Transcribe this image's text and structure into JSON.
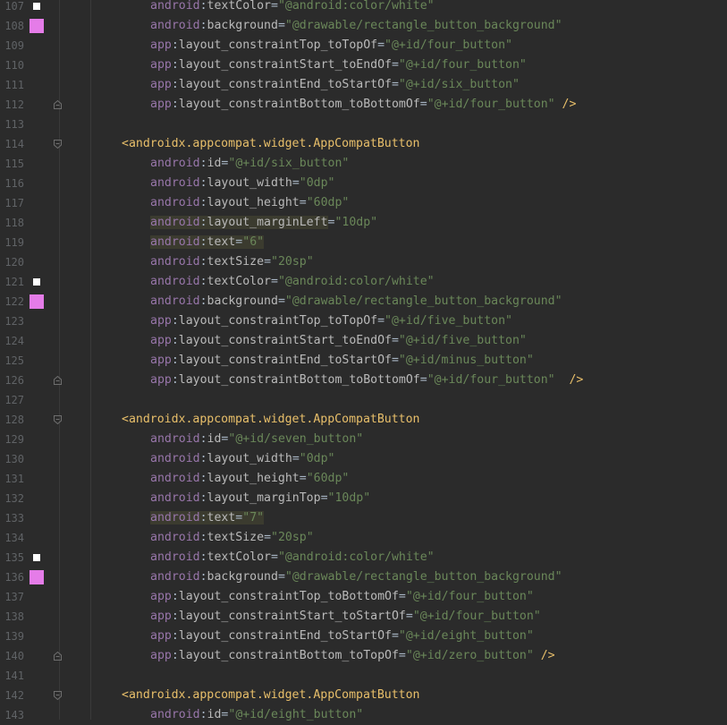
{
  "editor": {
    "lines": [
      {
        "num": "107",
        "indent": 2,
        "segments": [
          {
            "c": "ns-android",
            "t": "android"
          },
          {
            "c": "punct",
            "t": ":"
          },
          {
            "c": "attr",
            "t": "textColor"
          },
          {
            "c": "punct",
            "t": "="
          },
          {
            "c": "val",
            "t": "\"@android:color/white\""
          }
        ],
        "gutter": "white"
      },
      {
        "num": "108",
        "indent": 2,
        "segments": [
          {
            "c": "ns-android",
            "t": "android"
          },
          {
            "c": "punct",
            "t": ":"
          },
          {
            "c": "attr",
            "t": "background"
          },
          {
            "c": "punct",
            "t": "="
          },
          {
            "c": "val",
            "t": "\"@drawable/rectangle_button_background\""
          }
        ],
        "gutter": "pink"
      },
      {
        "num": "109",
        "indent": 2,
        "segments": [
          {
            "c": "ns-app",
            "t": "app"
          },
          {
            "c": "punct",
            "t": ":"
          },
          {
            "c": "attr",
            "t": "layout_constraintTop_toTopOf"
          },
          {
            "c": "punct",
            "t": "="
          },
          {
            "c": "val",
            "t": "\"@+id/four_button\""
          }
        ]
      },
      {
        "num": "110",
        "indent": 2,
        "segments": [
          {
            "c": "ns-app",
            "t": "app"
          },
          {
            "c": "punct",
            "t": ":"
          },
          {
            "c": "attr",
            "t": "layout_constraintStart_toEndOf"
          },
          {
            "c": "punct",
            "t": "="
          },
          {
            "c": "val",
            "t": "\"@+id/four_button\""
          }
        ]
      },
      {
        "num": "111",
        "indent": 2,
        "segments": [
          {
            "c": "ns-app",
            "t": "app"
          },
          {
            "c": "punct",
            "t": ":"
          },
          {
            "c": "attr",
            "t": "layout_constraintEnd_toStartOf"
          },
          {
            "c": "punct",
            "t": "="
          },
          {
            "c": "val",
            "t": "\"@+id/six_button\""
          }
        ]
      },
      {
        "num": "112",
        "indent": 2,
        "segments": [
          {
            "c": "ns-app",
            "t": "app"
          },
          {
            "c": "punct",
            "t": ":"
          },
          {
            "c": "attr",
            "t": "layout_constraintBottom_toBottomOf"
          },
          {
            "c": "punct",
            "t": "="
          },
          {
            "c": "val",
            "t": "\"@+id/four_button\""
          },
          {
            "c": "tag",
            "t": " />"
          }
        ],
        "fold": "end"
      },
      {
        "num": "113",
        "indent": 0,
        "segments": []
      },
      {
        "num": "114",
        "indent": 1,
        "segments": [
          {
            "c": "tag",
            "t": "<androidx.appcompat.widget.AppCompatButton"
          }
        ],
        "fold": "start"
      },
      {
        "num": "115",
        "indent": 2,
        "segments": [
          {
            "c": "ns-android",
            "t": "android"
          },
          {
            "c": "punct",
            "t": ":"
          },
          {
            "c": "attr",
            "t": "id"
          },
          {
            "c": "punct",
            "t": "="
          },
          {
            "c": "val",
            "t": "\"@+id/six_button\""
          }
        ]
      },
      {
        "num": "116",
        "indent": 2,
        "segments": [
          {
            "c": "ns-android",
            "t": "android"
          },
          {
            "c": "punct",
            "t": ":"
          },
          {
            "c": "attr",
            "t": "layout_width"
          },
          {
            "c": "punct",
            "t": "="
          },
          {
            "c": "val",
            "t": "\"0dp\""
          }
        ]
      },
      {
        "num": "117",
        "indent": 2,
        "segments": [
          {
            "c": "ns-android",
            "t": "android"
          },
          {
            "c": "punct",
            "t": ":"
          },
          {
            "c": "attr",
            "t": "layout_height"
          },
          {
            "c": "punct",
            "t": "="
          },
          {
            "c": "val",
            "t": "\"60dp\""
          }
        ]
      },
      {
        "num": "118",
        "indent": 2,
        "segments": [
          {
            "c": "ns-android hl",
            "t": "android"
          },
          {
            "c": "punct hl",
            "t": ":"
          },
          {
            "c": "attr hl",
            "t": "layout_marginLeft"
          },
          {
            "c": "punct",
            "t": "="
          },
          {
            "c": "val",
            "t": "\"10dp\""
          }
        ]
      },
      {
        "num": "119",
        "indent": 2,
        "segments": [
          {
            "c": "ns-android hl",
            "t": "android"
          },
          {
            "c": "punct hl",
            "t": ":"
          },
          {
            "c": "attr hl",
            "t": "text"
          },
          {
            "c": "punct hl",
            "t": "="
          },
          {
            "c": "val hl",
            "t": "\"6\""
          }
        ]
      },
      {
        "num": "120",
        "indent": 2,
        "segments": [
          {
            "c": "ns-android",
            "t": "android"
          },
          {
            "c": "punct",
            "t": ":"
          },
          {
            "c": "attr",
            "t": "textSize"
          },
          {
            "c": "punct",
            "t": "="
          },
          {
            "c": "val",
            "t": "\"20sp\""
          }
        ]
      },
      {
        "num": "121",
        "indent": 2,
        "segments": [
          {
            "c": "ns-android",
            "t": "android"
          },
          {
            "c": "punct",
            "t": ":"
          },
          {
            "c": "attr",
            "t": "textColor"
          },
          {
            "c": "punct",
            "t": "="
          },
          {
            "c": "val",
            "t": "\"@android:color/white\""
          }
        ],
        "gutter": "white"
      },
      {
        "num": "122",
        "indent": 2,
        "segments": [
          {
            "c": "ns-android",
            "t": "android"
          },
          {
            "c": "punct",
            "t": ":"
          },
          {
            "c": "attr",
            "t": "background"
          },
          {
            "c": "punct",
            "t": "="
          },
          {
            "c": "val",
            "t": "\"@drawable/rectangle_button_background\""
          }
        ],
        "gutter": "pink"
      },
      {
        "num": "123",
        "indent": 2,
        "segments": [
          {
            "c": "ns-app",
            "t": "app"
          },
          {
            "c": "punct",
            "t": ":"
          },
          {
            "c": "attr",
            "t": "layout_constraintTop_toTopOf"
          },
          {
            "c": "punct",
            "t": "="
          },
          {
            "c": "val",
            "t": "\"@+id/five_button\""
          }
        ]
      },
      {
        "num": "124",
        "indent": 2,
        "segments": [
          {
            "c": "ns-app",
            "t": "app"
          },
          {
            "c": "punct",
            "t": ":"
          },
          {
            "c": "attr",
            "t": "layout_constraintStart_toEndOf"
          },
          {
            "c": "punct",
            "t": "="
          },
          {
            "c": "val",
            "t": "\"@+id/five_button\""
          }
        ]
      },
      {
        "num": "125",
        "indent": 2,
        "segments": [
          {
            "c": "ns-app",
            "t": "app"
          },
          {
            "c": "punct",
            "t": ":"
          },
          {
            "c": "attr",
            "t": "layout_constraintEnd_toStartOf"
          },
          {
            "c": "punct",
            "t": "="
          },
          {
            "c": "val",
            "t": "\"@+id/minus_button\""
          }
        ]
      },
      {
        "num": "126",
        "indent": 2,
        "segments": [
          {
            "c": "ns-app",
            "t": "app"
          },
          {
            "c": "punct",
            "t": ":"
          },
          {
            "c": "attr",
            "t": "layout_constraintBottom_toBottomOf"
          },
          {
            "c": "punct",
            "t": "="
          },
          {
            "c": "val",
            "t": "\"@+id/four_button\""
          },
          {
            "c": "tag",
            "t": "  />"
          }
        ],
        "fold": "end"
      },
      {
        "num": "127",
        "indent": 0,
        "segments": []
      },
      {
        "num": "128",
        "indent": 1,
        "segments": [
          {
            "c": "tag",
            "t": "<androidx.appcompat.widget.AppCompatButton"
          }
        ],
        "fold": "start"
      },
      {
        "num": "129",
        "indent": 2,
        "segments": [
          {
            "c": "ns-android",
            "t": "android"
          },
          {
            "c": "punct",
            "t": ":"
          },
          {
            "c": "attr",
            "t": "id"
          },
          {
            "c": "punct",
            "t": "="
          },
          {
            "c": "val",
            "t": "\"@+id/seven_button\""
          }
        ]
      },
      {
        "num": "130",
        "indent": 2,
        "segments": [
          {
            "c": "ns-android",
            "t": "android"
          },
          {
            "c": "punct",
            "t": ":"
          },
          {
            "c": "attr",
            "t": "layout_width"
          },
          {
            "c": "punct",
            "t": "="
          },
          {
            "c": "val",
            "t": "\"0dp\""
          }
        ]
      },
      {
        "num": "131",
        "indent": 2,
        "segments": [
          {
            "c": "ns-android",
            "t": "android"
          },
          {
            "c": "punct",
            "t": ":"
          },
          {
            "c": "attr",
            "t": "layout_height"
          },
          {
            "c": "punct",
            "t": "="
          },
          {
            "c": "val",
            "t": "\"60dp\""
          }
        ]
      },
      {
        "num": "132",
        "indent": 2,
        "segments": [
          {
            "c": "ns-android",
            "t": "android"
          },
          {
            "c": "punct",
            "t": ":"
          },
          {
            "c": "attr",
            "t": "layout_marginTop"
          },
          {
            "c": "punct",
            "t": "="
          },
          {
            "c": "val",
            "t": "\"10dp\""
          }
        ]
      },
      {
        "num": "133",
        "indent": 2,
        "segments": [
          {
            "c": "ns-android hl",
            "t": "android"
          },
          {
            "c": "punct hl",
            "t": ":"
          },
          {
            "c": "attr hl",
            "t": "text"
          },
          {
            "c": "punct hl",
            "t": "="
          },
          {
            "c": "val hl",
            "t": "\"7\""
          }
        ]
      },
      {
        "num": "134",
        "indent": 2,
        "segments": [
          {
            "c": "ns-android",
            "t": "android"
          },
          {
            "c": "punct",
            "t": ":"
          },
          {
            "c": "attr",
            "t": "textSize"
          },
          {
            "c": "punct",
            "t": "="
          },
          {
            "c": "val",
            "t": "\"20sp\""
          }
        ]
      },
      {
        "num": "135",
        "indent": 2,
        "segments": [
          {
            "c": "ns-android",
            "t": "android"
          },
          {
            "c": "punct",
            "t": ":"
          },
          {
            "c": "attr",
            "t": "textColor"
          },
          {
            "c": "punct",
            "t": "="
          },
          {
            "c": "val",
            "t": "\"@android:color/white\""
          }
        ],
        "gutter": "white"
      },
      {
        "num": "136",
        "indent": 2,
        "segments": [
          {
            "c": "ns-android",
            "t": "android"
          },
          {
            "c": "punct",
            "t": ":"
          },
          {
            "c": "attr",
            "t": "background"
          },
          {
            "c": "punct",
            "t": "="
          },
          {
            "c": "val",
            "t": "\"@drawable/rectangle_button_background\""
          }
        ],
        "gutter": "pink"
      },
      {
        "num": "137",
        "indent": 2,
        "segments": [
          {
            "c": "ns-app",
            "t": "app"
          },
          {
            "c": "punct",
            "t": ":"
          },
          {
            "c": "attr",
            "t": "layout_constraintTop_toBottomOf"
          },
          {
            "c": "punct",
            "t": "="
          },
          {
            "c": "val",
            "t": "\"@+id/four_button\""
          }
        ]
      },
      {
        "num": "138",
        "indent": 2,
        "segments": [
          {
            "c": "ns-app",
            "t": "app"
          },
          {
            "c": "punct",
            "t": ":"
          },
          {
            "c": "attr",
            "t": "layout_constraintStart_toStartOf"
          },
          {
            "c": "punct",
            "t": "="
          },
          {
            "c": "val",
            "t": "\"@+id/four_button\""
          }
        ]
      },
      {
        "num": "139",
        "indent": 2,
        "segments": [
          {
            "c": "ns-app",
            "t": "app"
          },
          {
            "c": "punct",
            "t": ":"
          },
          {
            "c": "attr",
            "t": "layout_constraintEnd_toStartOf"
          },
          {
            "c": "punct",
            "t": "="
          },
          {
            "c": "val",
            "t": "\"@+id/eight_button\""
          }
        ]
      },
      {
        "num": "140",
        "indent": 2,
        "segments": [
          {
            "c": "ns-app",
            "t": "app"
          },
          {
            "c": "punct",
            "t": ":"
          },
          {
            "c": "attr",
            "t": "layout_constraintBottom_toTopOf"
          },
          {
            "c": "punct",
            "t": "="
          },
          {
            "c": "val",
            "t": "\"@+id/zero_button\""
          },
          {
            "c": "tag",
            "t": " />"
          }
        ],
        "fold": "end"
      },
      {
        "num": "141",
        "indent": 0,
        "segments": []
      },
      {
        "num": "142",
        "indent": 1,
        "segments": [
          {
            "c": "tag",
            "t": "<androidx.appcompat.widget.AppCompatButton"
          }
        ],
        "fold": "start"
      },
      {
        "num": "143",
        "indent": 2,
        "segments": [
          {
            "c": "ns-android",
            "t": "android"
          },
          {
            "c": "punct",
            "t": ":"
          },
          {
            "c": "attr",
            "t": "id"
          },
          {
            "c": "punct",
            "t": "="
          },
          {
            "c": "val",
            "t": "\"@+id/eight_button\""
          }
        ]
      }
    ]
  },
  "colors": {
    "background": "#2b2b2b",
    "swatch_pink": "#e57ce8",
    "swatch_white": "#ffffff"
  }
}
